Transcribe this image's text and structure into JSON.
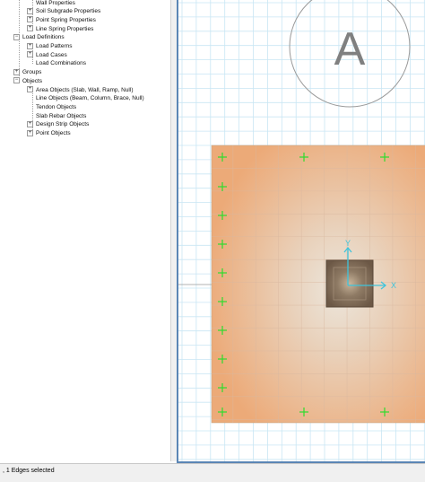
{
  "tree": {
    "items": [
      {
        "label": "Wall Properties",
        "level": 2,
        "expander": ""
      },
      {
        "label": "Soil Subgrade Properties",
        "level": 2,
        "expander": "+"
      },
      {
        "label": "Point Spring Properties",
        "level": 2,
        "expander": "+"
      },
      {
        "label": "Line Spring Properties",
        "level": 2,
        "expander": "+"
      },
      {
        "label": "Load Definitions",
        "level": 1,
        "expander": "−"
      },
      {
        "label": "Load Patterns",
        "level": 2,
        "expander": "+"
      },
      {
        "label": "Load Cases",
        "level": 2,
        "expander": "+"
      },
      {
        "label": "Load Combinations",
        "level": 2,
        "expander": ""
      },
      {
        "label": "Groups",
        "level": 1,
        "expander": "+"
      },
      {
        "label": "Objects",
        "level": 1,
        "expander": "−"
      },
      {
        "label": "Area Objects (Slab, Wall, Ramp, Null)",
        "level": 2,
        "expander": "+"
      },
      {
        "label": "Line Objects (Beam, Column, Brace, Null)",
        "level": 2,
        "expander": ""
      },
      {
        "label": "Tendon Objects",
        "level": 2,
        "expander": ""
      },
      {
        "label": "Slab Rebar Objects",
        "level": 2,
        "expander": ""
      },
      {
        "label": "Design Strip Objects",
        "level": 2,
        "expander": "+"
      },
      {
        "label": "Point Objects",
        "level": 2,
        "expander": "+"
      }
    ]
  },
  "model": {
    "grid_bubble_label": "A",
    "axis_x_label": "X",
    "axis_y_label": "Y",
    "colors": {
      "grid": "#c9e6f4",
      "slab_edge": "#ecaa78",
      "slab_center": "#ece6dc",
      "column": "#7d6650",
      "axis": "#3ec4dc",
      "support_marker": "#2edc2e",
      "frame_border": "#5b86b5"
    }
  },
  "status": {
    "text": ", 1 Edges selected"
  }
}
